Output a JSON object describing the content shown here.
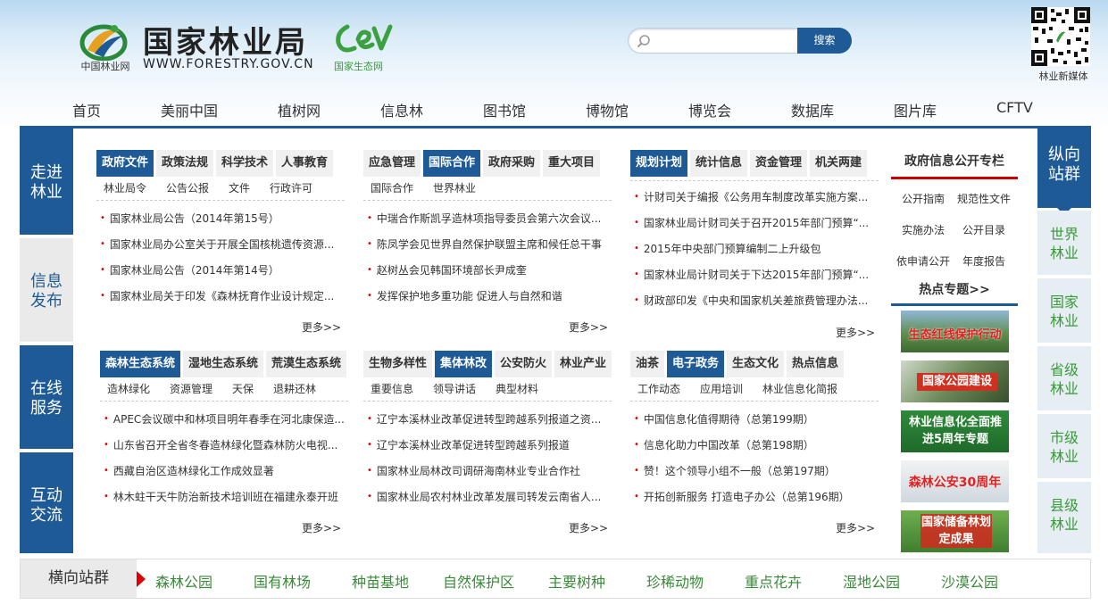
{
  "header": {
    "logo_sub": "中国林业网",
    "title": "国家林业局",
    "url": "WWW.FORESTRY.GOV.CN",
    "eco_sub": "国家生态网",
    "search_placeholder": "",
    "search_button": "搜索",
    "qr_label": "林业新媒体"
  },
  "nav": [
    "首页",
    "美丽中国",
    "植树网",
    "信息林",
    "图书馆",
    "博物馆",
    "博览会",
    "数据库",
    "图片库",
    "CFTV"
  ],
  "left_sidebar": [
    {
      "line1": "走进",
      "line2": "林业"
    },
    {
      "line1": "信息",
      "line2": "发布"
    },
    {
      "line1": "在线",
      "line2": "服务"
    },
    {
      "line1": "互动",
      "line2": "交流"
    }
  ],
  "right_sidebar": {
    "top": {
      "line1": "纵向",
      "line2": "站群"
    },
    "items": [
      {
        "line1": "世界",
        "line2": "林业"
      },
      {
        "line1": "国家",
        "line2": "林业"
      },
      {
        "line1": "省级",
        "line2": "林业"
      },
      {
        "line1": "市级",
        "line2": "林业"
      },
      {
        "line1": "县级",
        "line2": "林业"
      }
    ]
  },
  "panels": [
    {
      "tabs": [
        "政府文件",
        "政策法规",
        "科学技术",
        "人事教育"
      ],
      "active": 0,
      "subs": [
        "林业局令",
        "公告公报",
        "文件",
        "行政许可"
      ],
      "news": [
        "国家林业局公告（2014年第15号）",
        "国家林业局办公室关于开展全国核桃遗传资源...",
        "国家林业局公告（2014年第14号）",
        "国家林业局关于印发《森林抚育作业设计规定..."
      ],
      "more": "更多>>"
    },
    {
      "tabs": [
        "应急管理",
        "国际合作",
        "政府采购",
        "重大项目"
      ],
      "active": 1,
      "subs": [
        "国际合作",
        "世界林业"
      ],
      "news": [
        "中瑞合作斯凯孚造林项指导委员会第六次会议...",
        "陈凤学会见世界自然保护联盟主席和候任总干事",
        "赵树丛会见韩国环境部长尹成奎",
        "发挥保护地多重功能 促进人与自然和谐"
      ],
      "more": "更多>>"
    },
    {
      "tabs": [
        "规划计划",
        "统计信息",
        "资金管理",
        "机关两建"
      ],
      "active": 0,
      "subs": [],
      "news": [
        "计财司关于编报《公务用车制度改革实施方案...",
        "国家林业局计财司关于召开2015年部门预算“...",
        "2015年中央部门预算编制二上升级包",
        "国家林业局计财司关于下达2015年部门预算“...",
        "财政部印发《中央和国家机关差旅费管理办法..."
      ],
      "more": "更多>>"
    },
    {
      "tabs": [
        "森林生态系统",
        "湿地生态系统",
        "荒漠生态系统"
      ],
      "active": 0,
      "subs": [
        "造林绿化",
        "资源管理",
        "天保",
        "退耕还林"
      ],
      "news": [
        "APEC会议碳中和林项目明年春季在河北康保造...",
        "山东省召开全省冬春造林绿化暨森林防火电视...",
        "西藏自治区造林绿化工作成效显著",
        "林木蛀干天牛防治新技术培训班在福建永泰开班"
      ],
      "more": "更多>>"
    },
    {
      "tabs": [
        "生物多样性",
        "集体林改",
        "公安防火",
        "林业产业"
      ],
      "active": 1,
      "subs": [
        "重要信息",
        "领导讲话",
        "典型材料"
      ],
      "news": [
        "辽宁本溪林业改革促进转型跨越系列报道之资...",
        "辽宁本溪林业改革促进转型跨越系列报道",
        "国家林业局林改司调研海南林业专业合作社",
        "国家林业局农村林业改革发展司转发云南省人..."
      ],
      "more": "更多>>"
    },
    {
      "tabs": [
        "油茶",
        "电子政务",
        "生态文化",
        "热点信息"
      ],
      "active": 1,
      "subs": [
        "工作动态",
        "应用培训",
        "林业信息化简报"
      ],
      "news": [
        "中国信息化值得期待（总第199期）",
        "信息化助力中国改革（总第198期）",
        "赞！这个领导小组不一般（总第197期）",
        "开拓创新服务 打造电子办公（总第196期）"
      ],
      "more": "更多>>"
    }
  ],
  "gov_info": {
    "title": "政府信息公开专栏",
    "links": [
      "公开指南",
      "规范性文件",
      "实施办法",
      "公开目录",
      "依申请公开",
      "年度报告"
    ]
  },
  "hot_topics": {
    "title": "热点专题>>",
    "items": [
      "生态红线保护行动",
      "国家公园建设",
      "林业信息化全面推进5周年专题",
      "森林公安30周年",
      "国家储备林划定成果"
    ]
  },
  "bottom_bar": {
    "label": "横向站群",
    "items": [
      "森林公园",
      "国有林场",
      "种苗基地",
      "自然保护区",
      "主要树种",
      "珍稀动物",
      "重点花卉",
      "湿地公园",
      "沙漠公园"
    ]
  },
  "colors": {
    "primary": "#1e5a96",
    "accent_red": "#cc0000",
    "green": "#3a9a3a"
  }
}
